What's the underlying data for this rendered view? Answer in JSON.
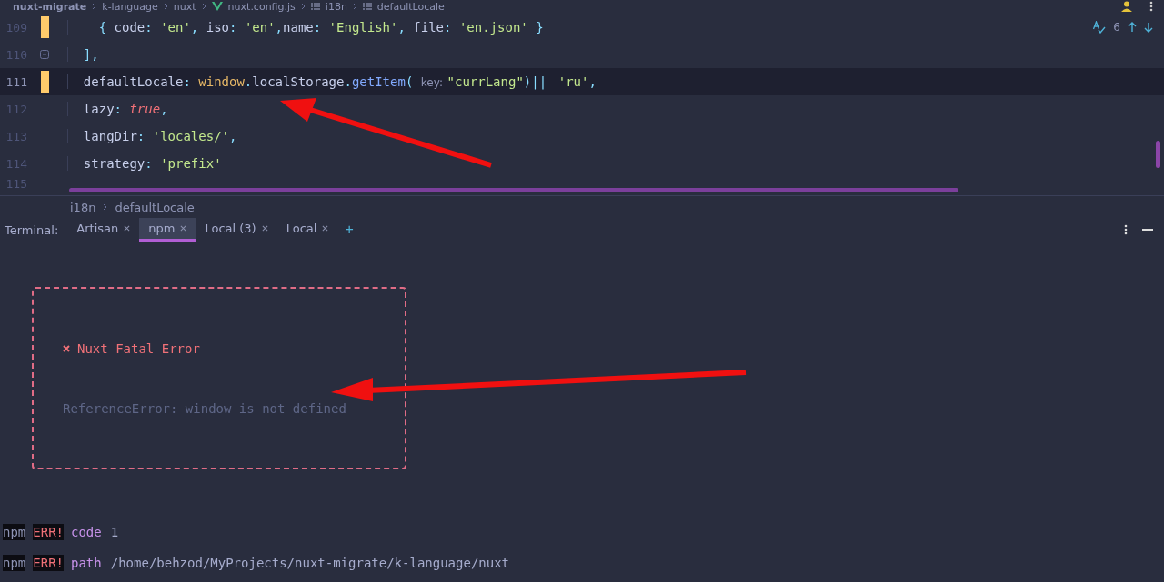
{
  "breadcrumb": [
    {
      "text": "nuxt-migrate",
      "kind": "directory"
    },
    {
      "text": "k-language",
      "kind": "directory"
    },
    {
      "text": "nuxt",
      "kind": "directory"
    },
    {
      "text": "nuxt.config.js",
      "kind": "file"
    },
    {
      "text": "i18n",
      "kind": "symbol"
    },
    {
      "text": "defaultLocale",
      "kind": "symbol"
    }
  ],
  "editor": {
    "inspection_count": "6",
    "lines": [
      {
        "number": "109",
        "modified": true,
        "fold": false,
        "current": false,
        "kind": "array_item",
        "tokens": [
          {
            "text": "{ ",
            "kind": "punct"
          },
          {
            "text": "code",
            "kind": "key"
          },
          {
            "text": ": ",
            "kind": "punct"
          },
          {
            "text": "'en'",
            "kind": "string"
          },
          {
            "text": ", ",
            "kind": "punct"
          },
          {
            "text": "iso",
            "kind": "key"
          },
          {
            "text": ": ",
            "kind": "punct"
          },
          {
            "text": "'en'",
            "kind": "string"
          },
          {
            "text": ",",
            "kind": "punct"
          },
          {
            "text": "name",
            "kind": "key"
          },
          {
            "text": ": ",
            "kind": "punct"
          },
          {
            "text": "'English'",
            "kind": "string"
          },
          {
            "text": ", ",
            "kind": "punct"
          },
          {
            "text": "file",
            "kind": "key"
          },
          {
            "text": ": ",
            "kind": "punct"
          },
          {
            "text": "'en.json'",
            "kind": "string"
          },
          {
            "text": " }",
            "kind": "punct"
          }
        ]
      },
      {
        "number": "110",
        "modified": false,
        "fold": true,
        "current": false,
        "kind": "property",
        "tokens": [
          {
            "text": "],",
            "kind": "punct"
          }
        ]
      },
      {
        "number": "111",
        "modified": true,
        "fold": false,
        "current": true,
        "kind": "property",
        "tokens": [
          {
            "text": "defaultLocale",
            "kind": "key"
          },
          {
            "text": ": ",
            "kind": "punct"
          },
          {
            "text": "window",
            "kind": "global"
          },
          {
            "text": ".",
            "kind": "punct"
          },
          {
            "text": "localStorage",
            "kind": "key"
          },
          {
            "text": ".",
            "kind": "punct"
          },
          {
            "text": "getItem",
            "kind": "method"
          },
          {
            "text": "( ",
            "kind": "punct"
          },
          {
            "text": "key:",
            "kind": "hint"
          },
          {
            "text": "\"currLang\"",
            "kind": "string"
          },
          {
            "text": ")",
            "kind": "punct"
          },
          {
            "text": "||",
            "kind": "operator"
          },
          {
            "text": "'ru'",
            "kind": "string"
          },
          {
            "text": ",",
            "kind": "punct"
          }
        ]
      },
      {
        "number": "112",
        "modified": false,
        "fold": false,
        "current": false,
        "kind": "property",
        "tokens": [
          {
            "text": "lazy",
            "kind": "key"
          },
          {
            "text": ": ",
            "kind": "punct"
          },
          {
            "text": "true",
            "kind": "keyword"
          },
          {
            "text": ",",
            "kind": "punct"
          }
        ]
      },
      {
        "number": "113",
        "modified": false,
        "fold": false,
        "current": false,
        "kind": "property",
        "tokens": [
          {
            "text": "langDir",
            "kind": "key"
          },
          {
            "text": ": ",
            "kind": "punct"
          },
          {
            "text": "'locales/'",
            "kind": "string"
          },
          {
            "text": ",",
            "kind": "punct"
          }
        ]
      },
      {
        "number": "114",
        "modified": false,
        "fold": false,
        "current": false,
        "kind": "property",
        "tokens": [
          {
            "text": "strategy",
            "kind": "key"
          },
          {
            "text": ": ",
            "kind": "punct"
          },
          {
            "text": "'prefix'",
            "kind": "string"
          }
        ]
      }
    ],
    "last_line_number": "115"
  },
  "structure_path": [
    "i18n",
    "defaultLocale"
  ],
  "terminal": {
    "label": "Terminal:",
    "tabs": [
      {
        "label": "Artisan",
        "selected": false
      },
      {
        "label": "npm",
        "selected": true
      },
      {
        "label": "Local (3)",
        "selected": false
      },
      {
        "label": "Local",
        "selected": false
      }
    ],
    "add_label": "+",
    "error_box": {
      "title": "Nuxt Fatal Error",
      "message": "ReferenceError: window is not defined"
    },
    "log": [
      {
        "prefix": "npm",
        "level": "ERR!",
        "key": "code",
        "value": "1"
      },
      {
        "prefix": "npm",
        "level": "ERR!",
        "key": "path",
        "value": "/home/behzod/MyProjects/nuxt-migrate/k-language/nuxt"
      }
    ]
  }
}
